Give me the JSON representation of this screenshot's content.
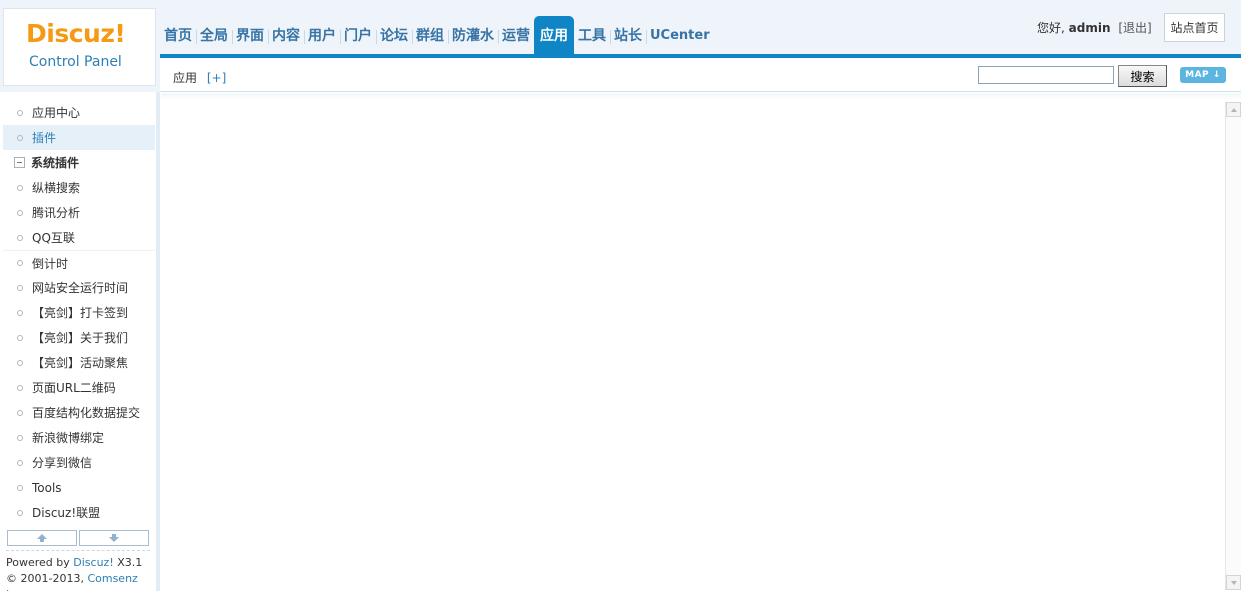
{
  "logo": {
    "title": "Discuz!",
    "subtitle": "Control Panel"
  },
  "nav": {
    "items": [
      "首页",
      "全局",
      "界面",
      "内容",
      "用户",
      "门户",
      "论坛",
      "群组",
      "防灌水",
      "运营",
      "应用",
      "工具",
      "站长",
      "UCenter"
    ],
    "active": "应用"
  },
  "user": {
    "greeting": "您好,",
    "name": "admin",
    "logout": "[退出]",
    "site_home": "站点首页"
  },
  "subbar": {
    "crumb": "应用",
    "add": "[+]",
    "search_button": "搜索",
    "map_button": "MAP ↓",
    "search_value": ""
  },
  "sidebar": {
    "items": [
      {
        "label": "应用中心",
        "type": "item"
      },
      {
        "label": "插件",
        "type": "item",
        "active": true
      },
      {
        "label": "系统插件",
        "type": "group"
      },
      {
        "label": "纵横搜索",
        "type": "item"
      },
      {
        "label": "腾讯分析",
        "type": "item"
      },
      {
        "label": "QQ互联",
        "type": "item"
      },
      {
        "label": "倒计时",
        "type": "item",
        "sep": true
      },
      {
        "label": "网站安全运行时间",
        "type": "item"
      },
      {
        "label": "【亮剑】打卡签到",
        "type": "item"
      },
      {
        "label": "【亮剑】关于我们",
        "type": "item"
      },
      {
        "label": "【亮剑】活动聚焦",
        "type": "item"
      },
      {
        "label": "页面URL二维码",
        "type": "item"
      },
      {
        "label": "百度结构化数据提交",
        "type": "item"
      },
      {
        "label": "新浪微博绑定",
        "type": "item"
      },
      {
        "label": "分享到微信",
        "type": "item"
      },
      {
        "label": "Tools",
        "type": "item"
      },
      {
        "label": "Discuz!联盟",
        "type": "item"
      }
    ]
  },
  "footer": {
    "powered": "Powered by",
    "powered_link": "Discuz!",
    "version": "X3.1",
    "copyright": "© 2001-2013,",
    "company": "Comsenz Inc."
  },
  "colors": {
    "accent": "#0f85c5",
    "logo": "#f59a12",
    "link": "#2e7fb4"
  }
}
